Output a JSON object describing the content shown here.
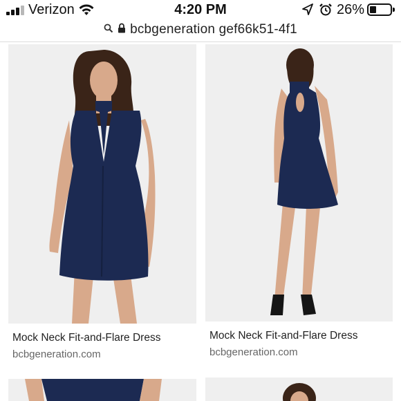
{
  "status_bar": {
    "carrier": "Verizon",
    "time": "4:20 PM",
    "battery_percent": "26%"
  },
  "url_bar": {
    "url": "bcbgeneration gef66k51-4f1"
  },
  "results": [
    {
      "title": "Mock Neck Fit-and-Flare Dress",
      "source": "bcbgeneration.com"
    },
    {
      "title": "Mock Neck Fit-and-Flare Dress",
      "source": "bcbgeneration.com"
    }
  ],
  "icons": {
    "signal": "cellular-signal-icon",
    "wifi": "wifi-icon",
    "location": "location-arrow-icon",
    "alarm": "alarm-clock-icon",
    "battery": "battery-icon",
    "search": "search-icon",
    "lock": "lock-icon"
  },
  "colors": {
    "dress": "#1c2a52",
    "photo_background": "#efefef"
  }
}
